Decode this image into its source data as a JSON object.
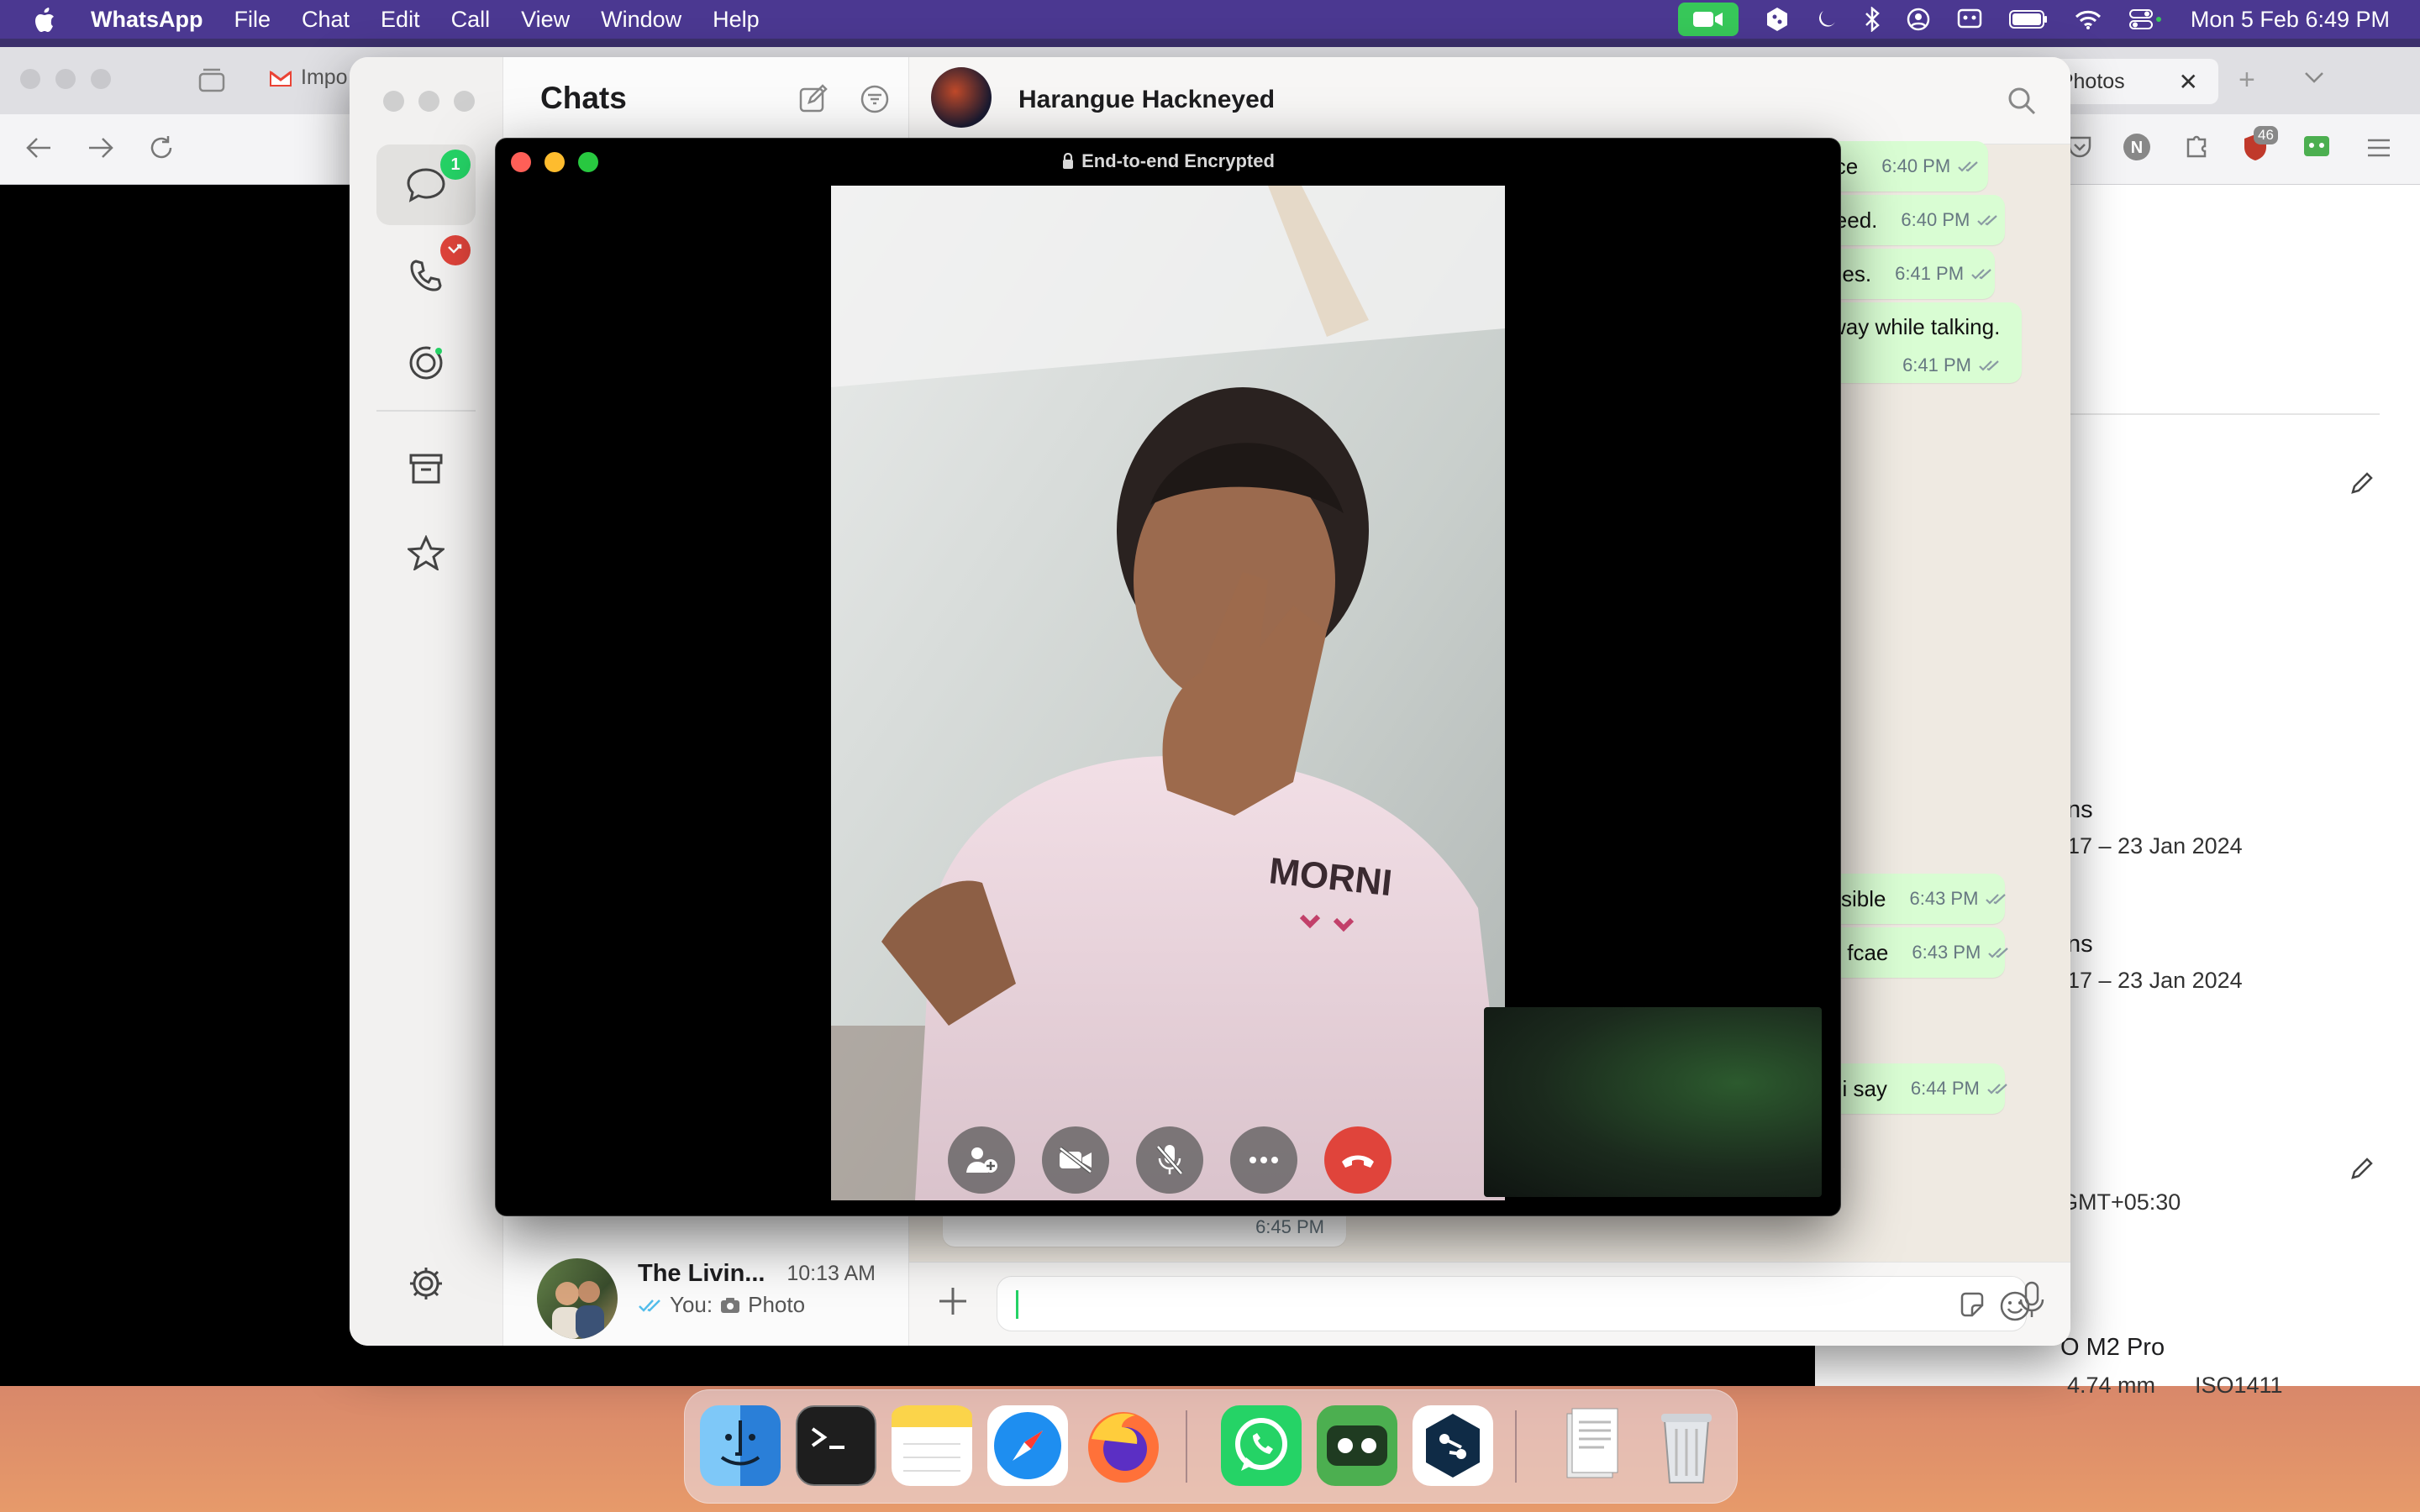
{
  "menubar": {
    "app": "WhatsApp",
    "items": [
      "File",
      "Chat",
      "Edit",
      "Call",
      "View",
      "Window",
      "Help"
    ],
    "clock": "Mon 5 Feb  6:49 PM"
  },
  "browser": {
    "tab_gmail": "Impo",
    "tab_photos": "e Photos",
    "ext_badge": "46",
    "right_panel": {
      "row1_title": "ns",
      "row1_date": "17 – 23 Jan 2024",
      "row2_title": "ns",
      "row2_date": "17 – 23 Jan 2024",
      "timezone": "GMT+05:30",
      "camera": "O M2 Pro",
      "exif_focal": "4.74 mm",
      "exif_iso": "ISO1411"
    }
  },
  "whatsapp": {
    "chats_title": "Chats",
    "chats_badge": "1",
    "contact_name": "Harangue Hackneyed",
    "chat_row": {
      "name": "The Livin...",
      "time": "10:13 AM",
      "you_label": "You:",
      "preview": "Photo"
    },
    "messages": [
      {
        "text": "ice",
        "time": "6:40 PM"
      },
      {
        "text": "leed.",
        "time": "6:40 PM"
      },
      {
        "text": "ries.",
        "time": "6:41 PM"
      },
      {
        "text": "way while talking.",
        "time": "6:41 PM"
      },
      {
        "text": "ssible",
        "time": "6:43 PM"
      },
      {
        "text": "y fcae",
        "time": "6:43 PM"
      },
      {
        "text": "t i say",
        "time": "6:44 PM"
      }
    ],
    "hidden_time": "6:45 PM"
  },
  "call": {
    "encrypted_label": "End-to-end Encrypted"
  },
  "colors": {
    "whatsapp_green": "#25d366",
    "bubble_out": "#d9fdd3",
    "end_call": "#e0443b",
    "menubar": "#4b3891"
  }
}
